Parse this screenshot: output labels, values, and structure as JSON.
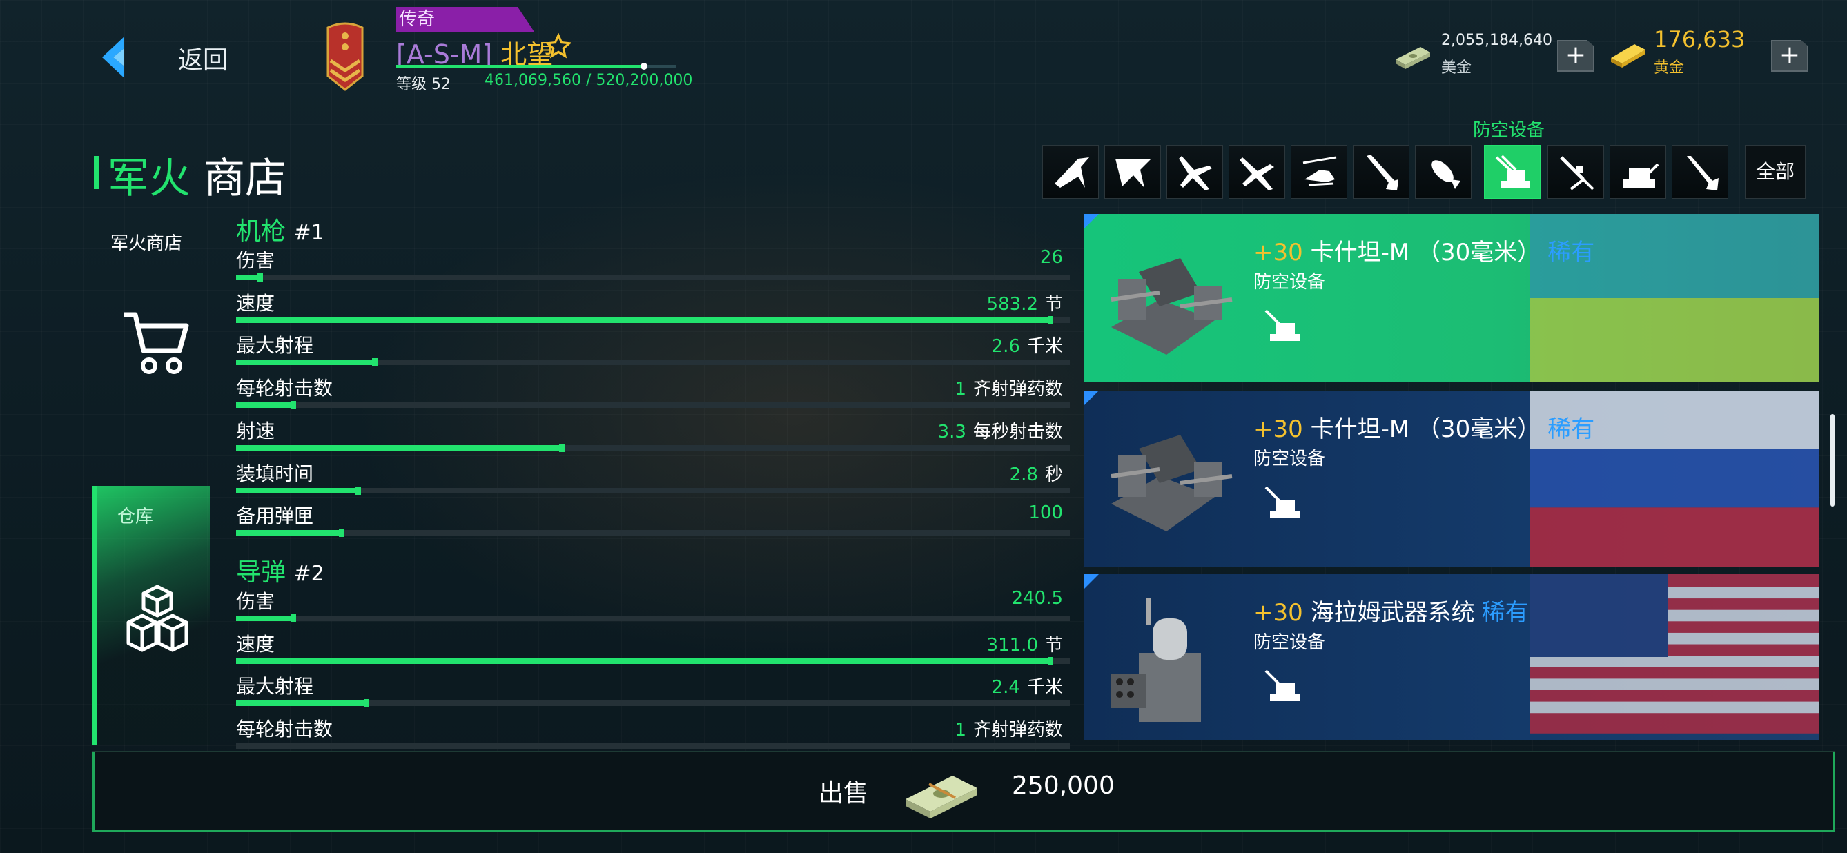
{
  "header": {
    "back_label": "返回",
    "tier": "传奇",
    "clan_tag": "[A-S-M]",
    "player_name": "北望",
    "level_label": "等级 52",
    "xp": "461,069,560 / 520,200,000",
    "xp_progress": 0.886
  },
  "currency": {
    "cash_value": "2,055,184,640",
    "cash_label": "美金",
    "gold_value": "176,633",
    "gold_label": "黄金",
    "plus": "+"
  },
  "page": {
    "title_a": "军火",
    "title_b": "商店",
    "active_category": "防空设备",
    "all_tab": "全部"
  },
  "tabs": [
    "jet-1-icon",
    "jet-2-icon",
    "jet-3-icon",
    "jet-4-icon",
    "helicopter-icon",
    "missile-icon",
    "bomb-icon",
    "aa-gun-icon",
    "rocket-launcher-icon",
    "turret-icon",
    "torpedo-icon"
  ],
  "nav": {
    "shop_label": "军火商店",
    "store_label": "仓库"
  },
  "sections": [
    {
      "name": "机枪",
      "num": "#1",
      "stats": [
        {
          "label": "伤害",
          "value": "26",
          "unit": "",
          "fill": 0.03
        },
        {
          "label": "速度",
          "value": "583.2",
          "unit": "节",
          "fill": 1.0
        },
        {
          "label": "最大射程",
          "value": "2.6",
          "unit": "千米",
          "fill": 0.17
        },
        {
          "label": "每轮射击数",
          "value": "1",
          "unit": "齐射弹药数",
          "fill": 0.07
        },
        {
          "label": "射速",
          "value": "3.3",
          "unit": "每秒射击数",
          "fill": 0.4
        },
        {
          "label": "装填时间",
          "value": "2.8",
          "unit": "秒",
          "fill": 0.15
        },
        {
          "label": "备用弹匣",
          "value": "100",
          "unit": "",
          "fill": 0.13
        }
      ]
    },
    {
      "name": "导弹",
      "num": "#2",
      "stats": [
        {
          "label": "伤害",
          "value": "240.5",
          "unit": "",
          "fill": 0.07
        },
        {
          "label": "速度",
          "value": "311.0",
          "unit": "节",
          "fill": 1.0
        },
        {
          "label": "最大射程",
          "value": "2.4",
          "unit": "千米",
          "fill": 0.16
        },
        {
          "label": "每轮射击数",
          "value": "1",
          "unit": "齐射弹药数",
          "fill": 0.0
        }
      ]
    }
  ],
  "items": [
    {
      "level": "+30",
      "name": "卡什坦-M （30毫米）",
      "rarity": "稀有",
      "type": "防空设备",
      "bg": "#1cbd74",
      "flag": "ukraine",
      "selected": true
    },
    {
      "level": "+30",
      "name": "卡什坦-M （30毫米）",
      "rarity": "稀有",
      "type": "防空设备",
      "bg": "#123563",
      "flag": "russia",
      "selected": false
    },
    {
      "level": "+30",
      "name": "海拉姆武器系统",
      "rarity": "稀有",
      "type": "防空设备",
      "bg": "#123563",
      "flag": "usa",
      "selected": false
    }
  ],
  "footer": {
    "sell_label": "出售",
    "price": "250,000"
  },
  "colors": {
    "accent": "#22e36e",
    "gold": "#f4c12e",
    "rarity": "#2b9dff",
    "tier": "#8a1fa8"
  }
}
